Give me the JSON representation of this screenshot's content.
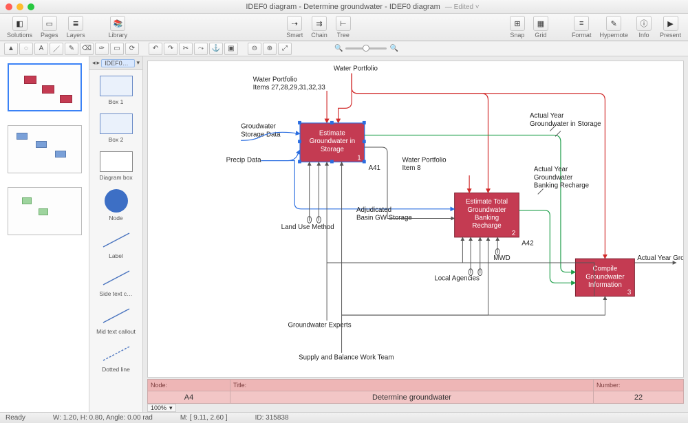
{
  "title": "IDEF0 diagram - Determine groundwater - IDEF0 diagram",
  "edited": "Edited",
  "toolbar": {
    "solutions": "Solutions",
    "pages": "Pages",
    "layers": "Layers",
    "library": "Library",
    "smart": "Smart",
    "chain": "Chain",
    "tree": "Tree",
    "snap": "Snap",
    "grid": "Grid",
    "format": "Format",
    "hypernote": "Hypernote",
    "info": "Info",
    "present": "Present"
  },
  "library": {
    "tab": "IDEF0…",
    "shapes": [
      {
        "id": "box1",
        "label": "Box 1"
      },
      {
        "id": "box2",
        "label": "Box 2"
      },
      {
        "id": "diagrambox",
        "label": "Diagram box"
      },
      {
        "id": "node",
        "label": "Node"
      },
      {
        "id": "label",
        "label": "Label"
      },
      {
        "id": "sidetext",
        "label": "Side text c…"
      },
      {
        "id": "midtext",
        "label": "Mid text callout"
      },
      {
        "id": "dotted",
        "label": "Dotted line"
      }
    ]
  },
  "diagram": {
    "labels": {
      "waterPortfolio": "Water Portfolio",
      "wpItems": "Water Portfolio\nItems 27,28,29,31,32,33",
      "gwStorageData": "Groudwater\nStorage Data",
      "precipData": "Precip Data",
      "landUseMethod": "Land Use Method",
      "adjBasin": "Adjudicated\nBasin GW Storage",
      "wpItem8": "Water Portfolio\nItem 8",
      "ayGwStorage": "Actual Year\nGroundwater in Storage",
      "ayGwBanking": "Actual Year\nGroundwater\nBanking Recharge",
      "ayGroundwater": "Actual Year Groundwater",
      "mwd": "MWD",
      "localAgencies": "Local Agencies",
      "gwExperts": "Groundwater Experts",
      "supplyTeam": "Supply and Balance Work Team"
    },
    "boxes": {
      "b1": {
        "title": "Estimate\nGroundwater in\nStorage",
        "num": "1",
        "id": "A41"
      },
      "b2": {
        "title": "Estimate Total\nGroundwater\nBanking\nRecharge",
        "num": "2",
        "id": "A42"
      },
      "b3": {
        "title": "Compile\nGroundwater\nInformation",
        "num": "3"
      }
    }
  },
  "footer": {
    "nodeHdr": "Node:",
    "node": "A4",
    "titleHdr": "Title:",
    "title": "Determine groundwater",
    "numberHdr": "Number:",
    "number": "22"
  },
  "zoom": "100%",
  "status": {
    "ready": "Ready",
    "wh": "W: 1.20,   H: 0.80,   Angle: 0.00 rad",
    "m": "M: [ 9.11, 2.60 ]",
    "id": "ID: 315838"
  }
}
